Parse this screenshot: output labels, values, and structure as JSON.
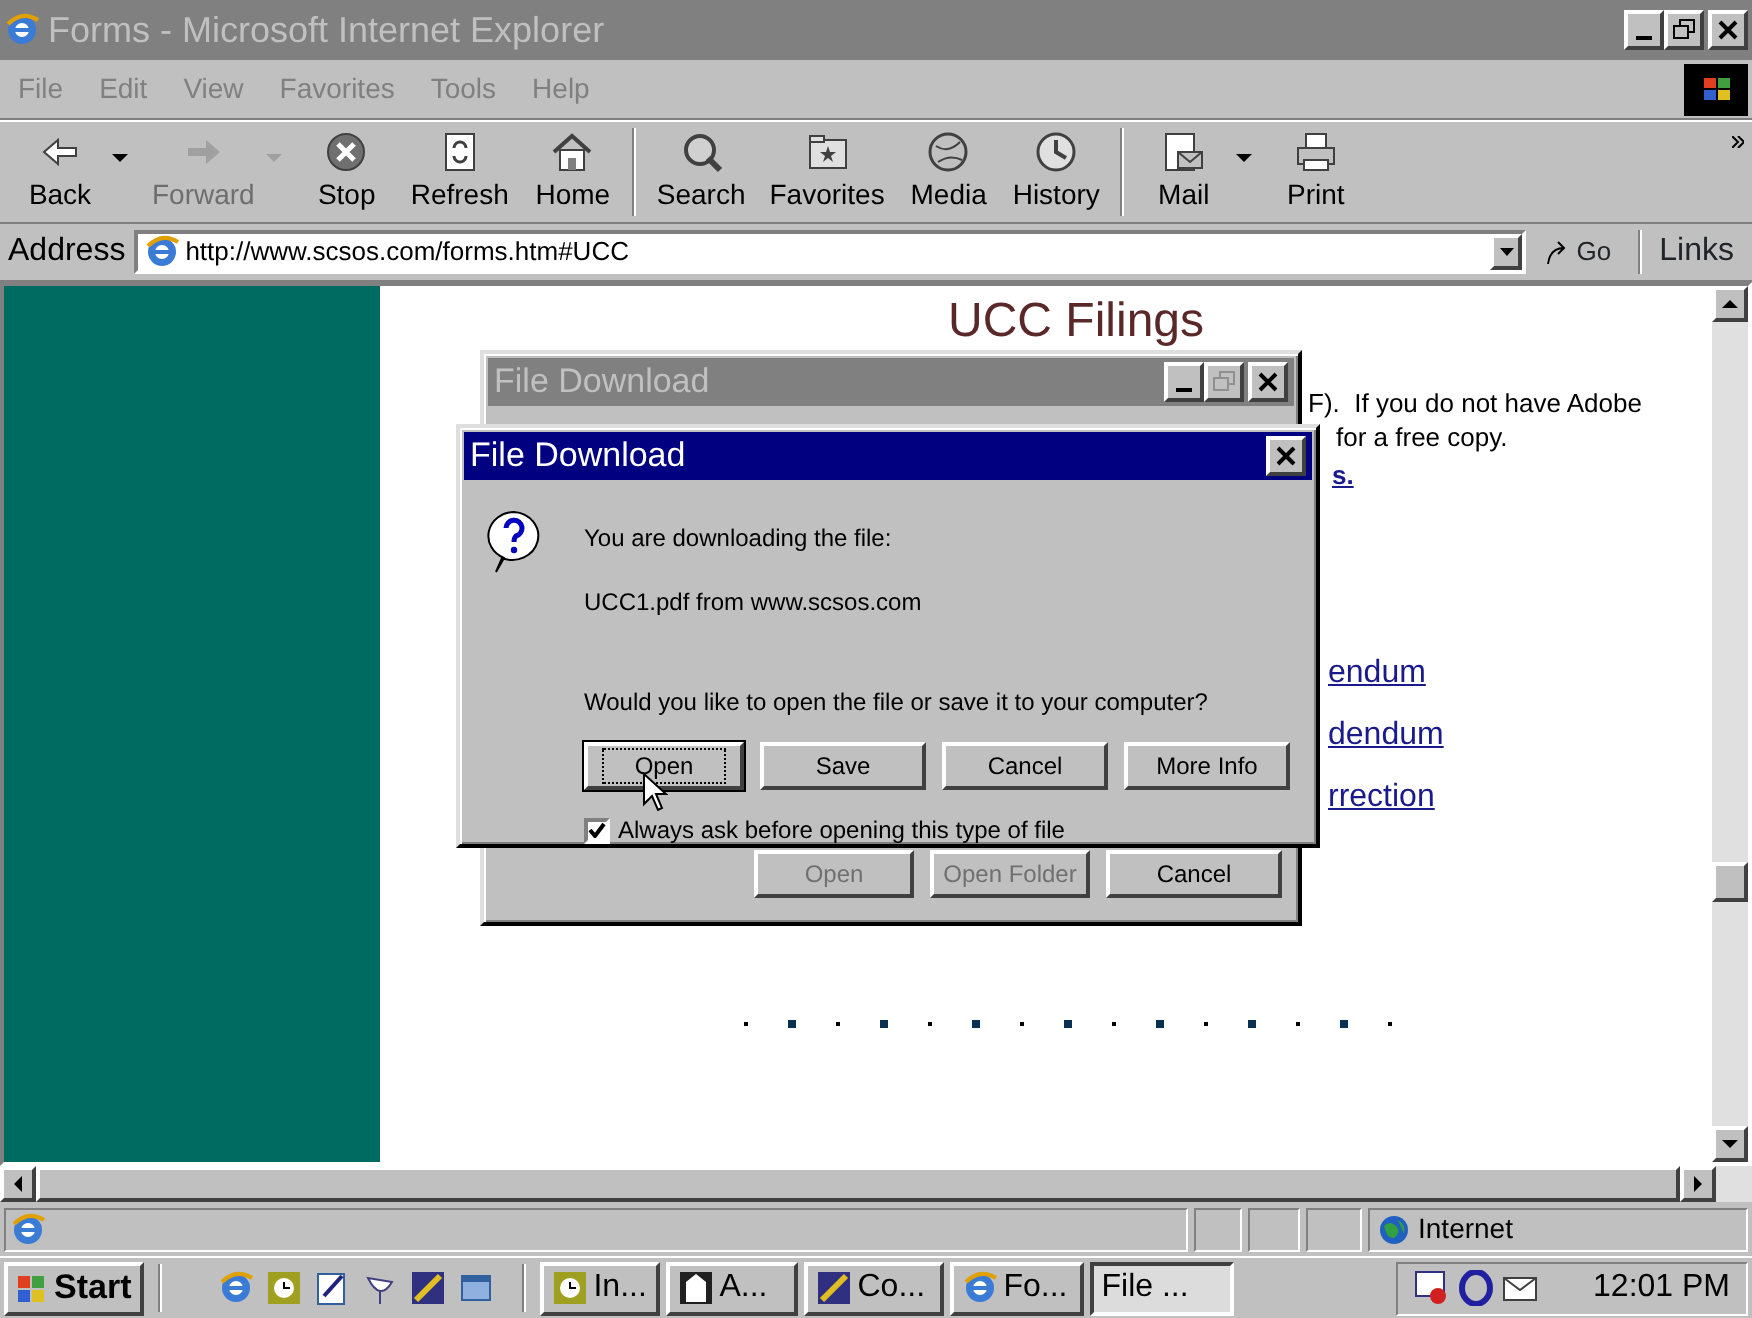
{
  "window": {
    "title": "Forms - Microsoft Internet Explorer",
    "active": false
  },
  "menu": [
    {
      "label": "File"
    },
    {
      "label": "Edit"
    },
    {
      "label": "View"
    },
    {
      "label": "Favorites"
    },
    {
      "label": "Tools"
    },
    {
      "label": "Help"
    }
  ],
  "toolbar": [
    {
      "kind": "button",
      "label": "Back",
      "disabled": false,
      "dropdown": true
    },
    {
      "kind": "button",
      "label": "Forward",
      "disabled": true,
      "dropdown": true
    },
    {
      "kind": "button",
      "label": "Stop",
      "disabled": false,
      "dropdown": false
    },
    {
      "kind": "button",
      "label": "Refresh",
      "disabled": false,
      "dropdown": false
    },
    {
      "kind": "button",
      "label": "Home",
      "disabled": false,
      "dropdown": false
    },
    {
      "kind": "separator"
    },
    {
      "kind": "button",
      "label": "Search",
      "disabled": false,
      "dropdown": false
    },
    {
      "kind": "button",
      "label": "Favorites",
      "disabled": false,
      "dropdown": false
    },
    {
      "kind": "button",
      "label": "Media",
      "disabled": false,
      "dropdown": false
    },
    {
      "kind": "button",
      "label": "History",
      "disabled": false,
      "dropdown": false
    },
    {
      "kind": "separator"
    },
    {
      "kind": "button",
      "label": "Mail",
      "disabled": false,
      "dropdown": true
    },
    {
      "kind": "button",
      "label": "Print",
      "disabled": false,
      "dropdown": false
    }
  ],
  "address": {
    "label": "Address",
    "url": "http://www.scsos.com/forms.htm#UCC",
    "go": "Go",
    "links": "Links"
  },
  "page": {
    "heading": "UCC Filings",
    "lines": [
      "F).  If you do not have Adobe",
      "for a free copy."
    ],
    "bold_link": "s.",
    "links": [
      "endum",
      "dendum",
      "rrection"
    ]
  },
  "back_dialog": {
    "title": "File Download",
    "active": false,
    "buttons": [
      {
        "label": "Open",
        "disabled": true
      },
      {
        "label": "Open Folder",
        "disabled": true
      },
      {
        "label": "Cancel",
        "disabled": false
      }
    ]
  },
  "dialog": {
    "title": "File Download",
    "active": true,
    "line_1": "You are downloading the file:",
    "line_2": "UCC1.pdf from www.scsos.com",
    "question": "Would you like to open the file or save it to your computer?",
    "buttons": [
      {
        "label": "Open",
        "default": true
      },
      {
        "label": "Save",
        "default": false
      },
      {
        "label": "Cancel",
        "default": false
      },
      {
        "label": "More Info",
        "default": false
      }
    ],
    "checkbox": {
      "label": "Always ask before opening this type of file",
      "checked": true
    }
  },
  "status_bar": {
    "zone": "Internet"
  },
  "taskbar": {
    "start": "Start",
    "tasks": [
      {
        "label": "In...",
        "selected": false
      },
      {
        "label": "A...",
        "selected": false
      },
      {
        "label": "Co...",
        "selected": false
      },
      {
        "label": "Fo...",
        "selected": false
      },
      {
        "label": "File ...",
        "selected": true
      }
    ],
    "clock": "12:01 PM"
  }
}
